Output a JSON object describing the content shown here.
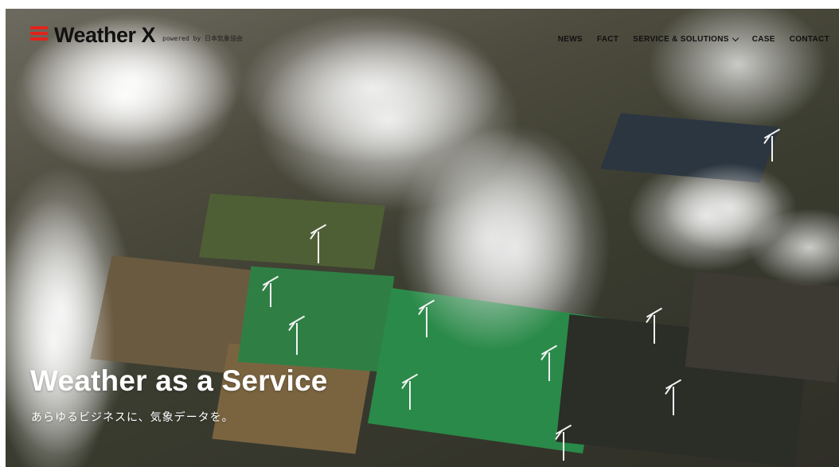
{
  "brand": {
    "name": "Weather X",
    "tagline": "powered by 日本気象協会",
    "accent_color": "#e2231a"
  },
  "nav": {
    "items": [
      {
        "label": "NEWS"
      },
      {
        "label": "FACT"
      },
      {
        "label": "SERVICE & SOLUTIONS",
        "has_dropdown": true
      },
      {
        "label": "CASE"
      },
      {
        "label": "CONTACT"
      }
    ]
  },
  "hero": {
    "title": "Weather as a Service",
    "subtitle": "あらゆるビジネスに、気象データを。",
    "background_image": "aerial-wind-farm-clouds"
  }
}
